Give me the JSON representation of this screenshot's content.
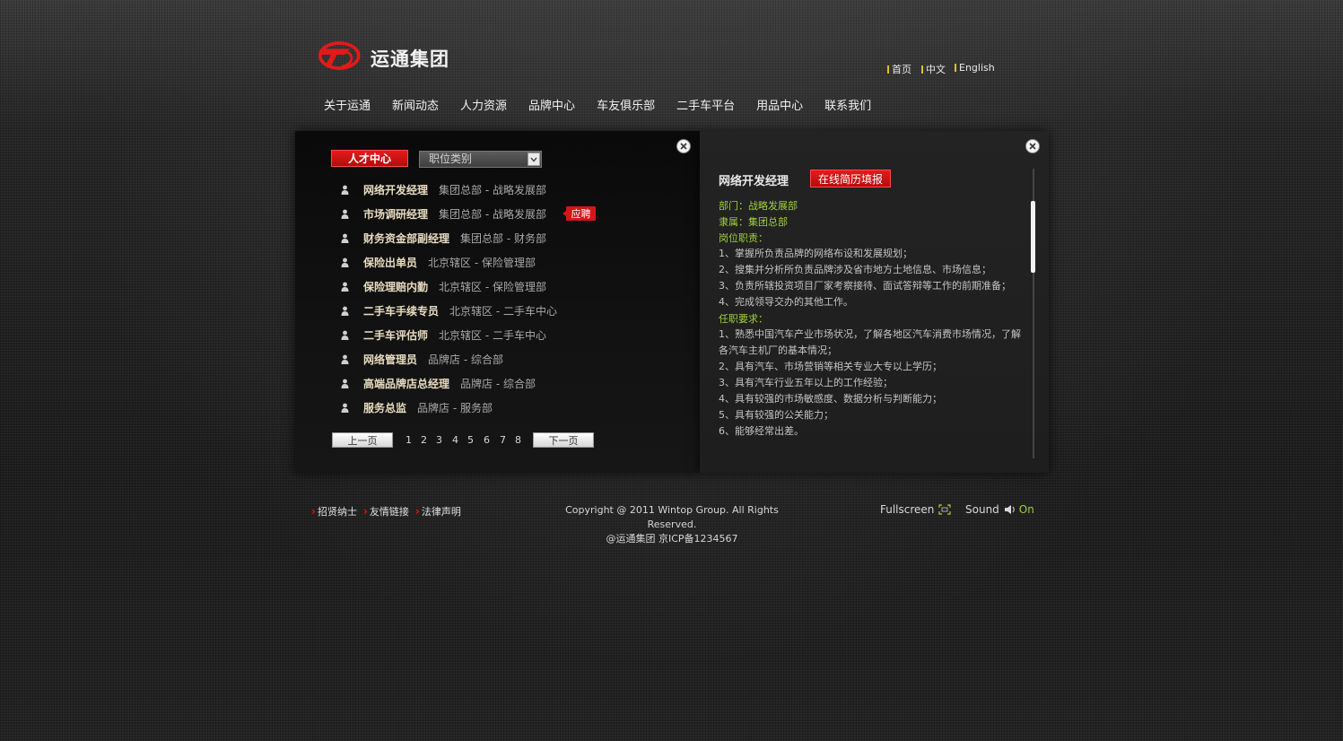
{
  "header": {
    "logo_text": "运通集团",
    "lang": [
      "首页",
      "中文",
      "English"
    ],
    "nav": [
      "关于运通",
      "新闻动态",
      "人力资源",
      "品牌中心",
      "车友俱乐部",
      "二手车平台",
      "用品中心",
      "联系我们"
    ]
  },
  "left": {
    "talent_tag": "人才中心",
    "select_value": "职位类别",
    "jobs": [
      {
        "title": "网络开发经理",
        "dept": "集团总部 - 战略发展部"
      },
      {
        "title": "市场调研经理",
        "dept": "集团总部 - 战略发展部"
      },
      {
        "title": "财务资金部副经理",
        "dept": "集团总部 - 财务部"
      },
      {
        "title": "保险出单员",
        "dept": "北京辖区 - 保险管理部"
      },
      {
        "title": "保险理赔内勤",
        "dept": "北京辖区 - 保险管理部"
      },
      {
        "title": "二手车手续专员",
        "dept": "北京辖区 - 二手车中心"
      },
      {
        "title": "二手车评估师",
        "dept": "北京辖区 - 二手车中心"
      },
      {
        "title": "网络管理员",
        "dept": "品牌店 - 综合部"
      },
      {
        "title": "高端品牌店总经理",
        "dept": "品牌店 - 综合部"
      },
      {
        "title": "服务总监",
        "dept": "品牌店 - 服务部"
      }
    ],
    "apply_label": "应聘",
    "prev_label": "上一页",
    "next_label": "下一页",
    "pages": [
      "1",
      "2",
      "3",
      "4",
      "5",
      "6",
      "7",
      "8"
    ]
  },
  "right": {
    "title": "网络开发经理",
    "apply_online": "在线简历填报",
    "dept": "部门：战略发展部",
    "belong": "隶属：集团总部",
    "duty_head": "岗位职责：",
    "duties": [
      "1、掌握所负责品牌的网络布设和发展规划；",
      "2、搜集并分析所负责品牌涉及省市地方土地信息、市场信息；",
      "3、负责所辖投资项目厂家考察接待、面试答辩等工作的前期准备；",
      "4、完成领导交办的其他工作。"
    ],
    "req_head": "任职要求：",
    "reqs": [
      "1、熟悉中国汽车产业市场状况，了解各地区汽车消费市场情况，了解各汽车主机厂的基本情况；",
      "2、具有汽车、市场营销等相关专业大专以上学历；",
      "3、具有汽车行业五年以上的工作经验；",
      "4、具有较强的市场敏感度、数据分析与判断能力；",
      "5、具有较强的公关能力；",
      "6、能够经常出差。"
    ]
  },
  "footer": {
    "links": [
      "招贤纳士",
      "友情链接",
      "法律声明"
    ],
    "copyright1": "Copyright @ 2011 Wintop Group. All Rights Reserved.",
    "copyright2": "@运通集团  京ICP备1234567",
    "fullscreen": "Fullscreen",
    "sound": "Sound",
    "sound_state": "On"
  },
  "colors": {
    "accent_red": "#d41616",
    "green": "#9fcf3f",
    "sound_on": "#9fcf3f"
  }
}
